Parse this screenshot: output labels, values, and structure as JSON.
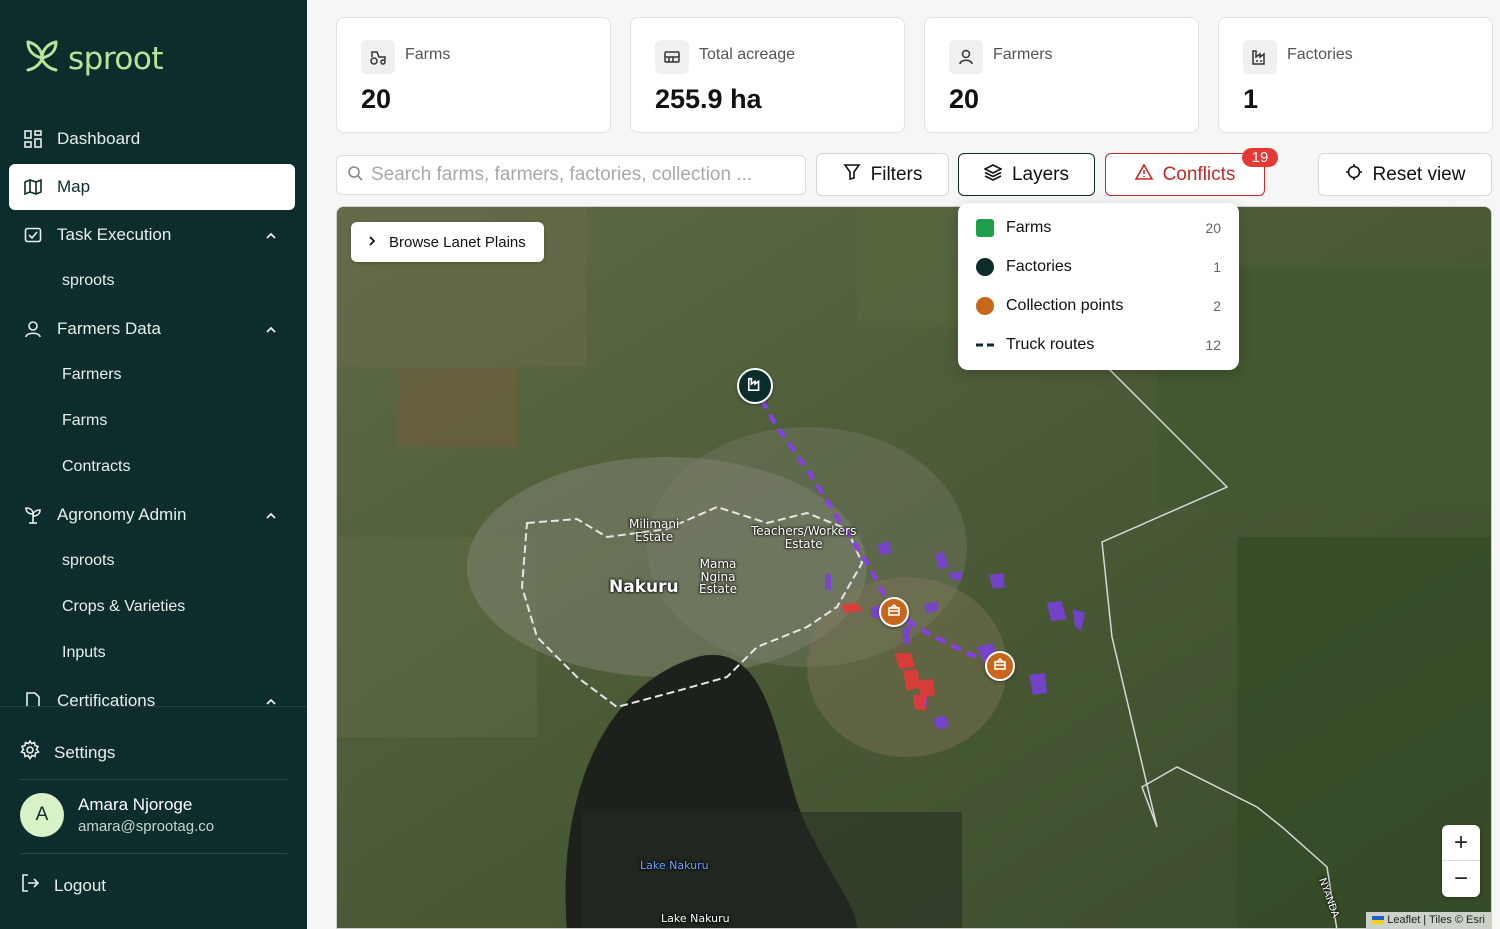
{
  "brand": {
    "name": "sproot",
    "accent": "#b6e59a",
    "sidebar_bg": "#0c2d2c"
  },
  "sidebar": {
    "items": [
      {
        "label": "Dashboard",
        "icon": "dashboard-icon"
      },
      {
        "label": "Map",
        "icon": "map-icon",
        "active": true
      },
      {
        "label": "Task Execution",
        "icon": "checkbox-icon",
        "expanded": true
      },
      {
        "label": "sproots"
      },
      {
        "label": "Farmers Data",
        "icon": "user-icon",
        "expanded": true
      },
      {
        "label": "Farmers"
      },
      {
        "label": "Farms"
      },
      {
        "label": "Contracts"
      },
      {
        "label": "Agronomy Admin",
        "icon": "sprout-icon",
        "expanded": true
      },
      {
        "label": "sproots"
      },
      {
        "label": "Crops & Varieties"
      },
      {
        "label": "Inputs"
      },
      {
        "label": "Certifications",
        "icon": "document-icon"
      }
    ],
    "settings_label": "Settings",
    "user": {
      "initial": "A",
      "name": "Amara Njoroge",
      "email": "amara@sprootag.co"
    },
    "logout_label": "Logout"
  },
  "stats": [
    {
      "label": "Farms",
      "value": "20",
      "icon": "tractor-icon"
    },
    {
      "label": "Total acreage",
      "value": "255.9 ha",
      "icon": "area-icon"
    },
    {
      "label": "Farmers",
      "value": "20",
      "icon": "user-icon"
    },
    {
      "label": "Factories",
      "value": "1",
      "icon": "factory-icon"
    }
  ],
  "toolbar": {
    "search_placeholder": "Search farms, farmers, factories, collection ...",
    "filters_label": "Filters",
    "layers_label": "Layers",
    "conflicts_label": "Conflicts",
    "conflicts_count": "19",
    "reset_label": "Reset view"
  },
  "layers": [
    {
      "label": "Farms",
      "count": "20",
      "color": "#1e9e4a"
    },
    {
      "label": "Factories",
      "count": "1",
      "color": "#0c2d2c"
    },
    {
      "label": "Collection points",
      "count": "2",
      "color": "#c8661b"
    },
    {
      "label": "Truck routes",
      "count": "12",
      "color": "#0c2d2c"
    }
  ],
  "map": {
    "browse_label": "Browse Lanet Plains",
    "labels": {
      "milimani": "Milimani\nEstate",
      "nakuru": "Nakuru",
      "teachers": "Teachers/Workers\nEstate",
      "mama": "Mama\nNgina\nEstate",
      "lake1": "Lake Nakuru",
      "lake2": "Lake Nakuru",
      "nyanda": "NYANDA"
    },
    "zoom_in": "+",
    "zoom_out": "−",
    "attribution": "Leaflet | Tiles © Esri",
    "route_color": "#8a3cf0",
    "farm_polygon_color": "#7b3fe0",
    "conflict_color": "#e53935"
  }
}
